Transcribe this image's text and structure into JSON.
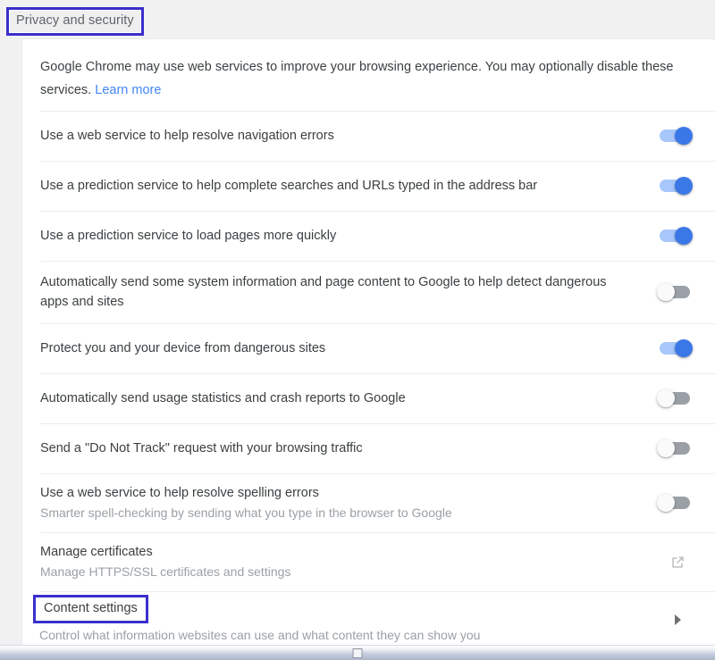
{
  "section": {
    "title": "Privacy and security",
    "annotation_color": "#3a2fcc"
  },
  "intro": {
    "text": "Google Chrome may use web services to improve your browsing experience. You may optionally disable these services.",
    "link_label": "Learn more",
    "link_color": "#4285f4"
  },
  "settings": [
    {
      "title": "Use a web service to help resolve navigation errors",
      "sub": "",
      "control": "toggle",
      "state": "on"
    },
    {
      "title": "Use a prediction service to help complete searches and URLs typed in the address bar",
      "sub": "",
      "control": "toggle",
      "state": "on"
    },
    {
      "title": "Use a prediction service to load pages more quickly",
      "sub": "",
      "control": "toggle",
      "state": "on"
    },
    {
      "title": "Automatically send some system information and page content to Google to help detect dangerous apps and sites",
      "sub": "",
      "control": "toggle",
      "state": "off"
    },
    {
      "title": "Protect you and your device from dangerous sites",
      "sub": "",
      "control": "toggle",
      "state": "on"
    },
    {
      "title": "Automatically send usage statistics and crash reports to Google",
      "sub": "",
      "control": "toggle",
      "state": "off"
    },
    {
      "title": "Send a \"Do Not Track\" request with your browsing traffic",
      "sub": "",
      "control": "toggle",
      "state": "off"
    },
    {
      "title": "Use a web service to help resolve spelling errors",
      "sub": "Smarter spell-checking by sending what you type in the browser to Google",
      "control": "toggle",
      "state": "off"
    }
  ],
  "navigation_rows": [
    {
      "title": "Manage certificates",
      "sub": "Manage HTTPS/SSL certificates and settings",
      "icon": "open-in-new-icon"
    },
    {
      "title": "Content settings",
      "sub": "Control what information websites can use and what content they can show you",
      "icon": "chevron-right-icon",
      "annotated": true
    }
  ],
  "toggle_colors": {
    "on_track": "#a8c7fa",
    "on_knob": "#3b78e7",
    "off_track": "#9aa0a6",
    "off_knob": "#fafafa"
  }
}
